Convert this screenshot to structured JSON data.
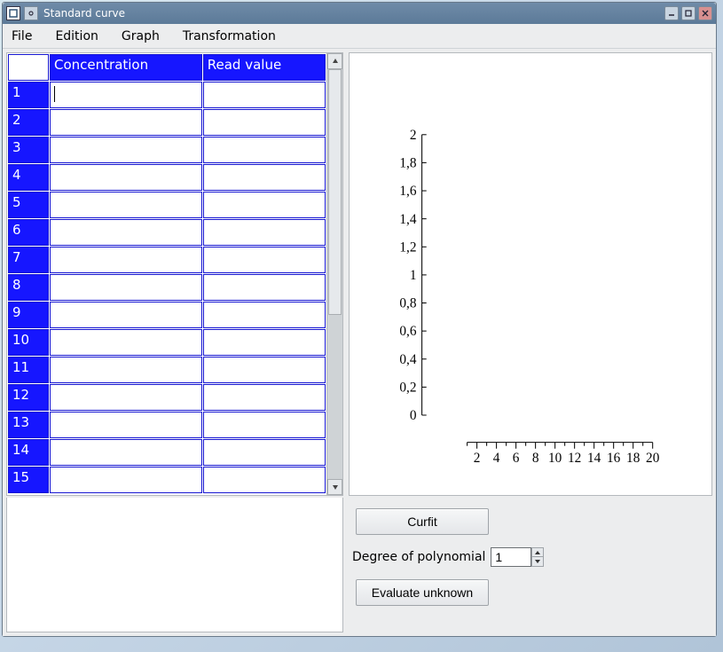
{
  "window": {
    "title": "Standard curve"
  },
  "menu": {
    "file": "File",
    "edition": "Edition",
    "graph": "Graph",
    "transformation": "Transformation"
  },
  "table": {
    "headers": {
      "concentration": "Concentration",
      "read_value": "Read value"
    },
    "rows": [
      {
        "n": "1",
        "c": "",
        "v": ""
      },
      {
        "n": "2",
        "c": "",
        "v": ""
      },
      {
        "n": "3",
        "c": "",
        "v": ""
      },
      {
        "n": "4",
        "c": "",
        "v": ""
      },
      {
        "n": "5",
        "c": "",
        "v": ""
      },
      {
        "n": "6",
        "c": "",
        "v": ""
      },
      {
        "n": "7",
        "c": "",
        "v": ""
      },
      {
        "n": "8",
        "c": "",
        "v": ""
      },
      {
        "n": "9",
        "c": "",
        "v": ""
      },
      {
        "n": "10",
        "c": "",
        "v": ""
      },
      {
        "n": "11",
        "c": "",
        "v": ""
      },
      {
        "n": "12",
        "c": "",
        "v": ""
      },
      {
        "n": "13",
        "c": "",
        "v": ""
      },
      {
        "n": "14",
        "c": "",
        "v": ""
      },
      {
        "n": "15",
        "c": "",
        "v": ""
      }
    ]
  },
  "controls": {
    "curfit": "Curfit",
    "degree_label": "Degree of polynomial",
    "degree_value": "1",
    "evaluate": "Evaluate unknown"
  },
  "chart_data": {
    "type": "scatter",
    "title": "",
    "xlabel": "",
    "ylabel": "",
    "xlim": [
      0,
      20
    ],
    "ylim": [
      0,
      2
    ],
    "x_ticks": [
      2,
      4,
      6,
      8,
      10,
      12,
      14,
      16,
      18,
      20
    ],
    "y_ticks": [
      0,
      0.2,
      0.4,
      0.6,
      0.8,
      1,
      1.2,
      1.4,
      1.6,
      1.8,
      2
    ],
    "y_tick_labels": [
      "0",
      "0,2",
      "0,4",
      "0,6",
      "0,8",
      "1",
      "1,2",
      "1,4",
      "1,6",
      "1,8",
      "2"
    ],
    "series": []
  }
}
